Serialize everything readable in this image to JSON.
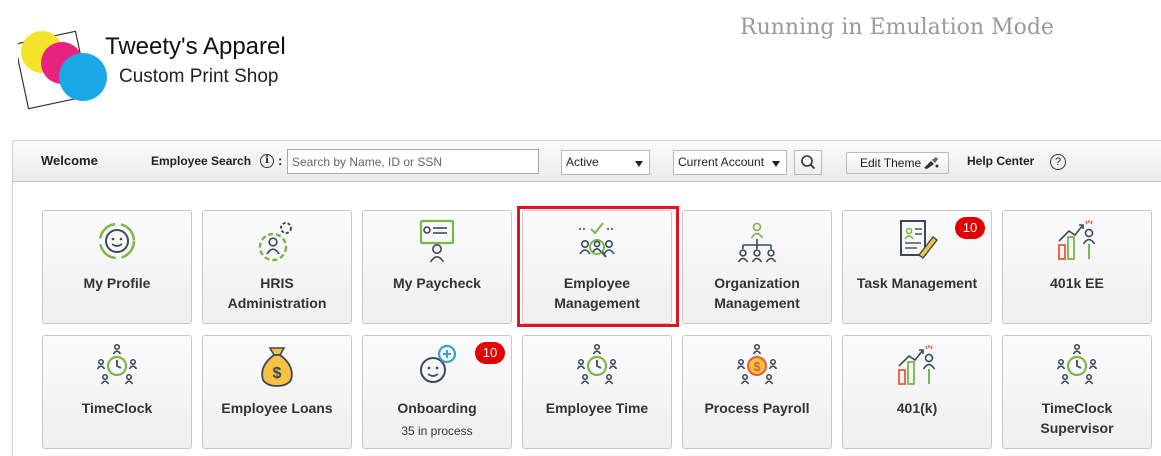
{
  "brand": {
    "name": "Tweety's Apparel",
    "tagline": "Custom Print Shop",
    "colors": [
      "#f5e22a",
      "#e8227f",
      "#1aa8e8"
    ]
  },
  "emulation_notice": "Running in Emulation Mode",
  "toolbar": {
    "welcome": "Welcome",
    "employee_search_label": "Employee Search",
    "info_icon": "i",
    "colon": ":",
    "search_placeholder": "Search by Name, ID or SSN",
    "status_select": "Active",
    "account_select": "Current Account",
    "edit_theme": "Edit Theme",
    "help_center": "Help Center",
    "help_icon": "?"
  },
  "tiles": [
    {
      "label": "My Profile",
      "icon": "profile-icon"
    },
    {
      "label": "HRIS\nAdministration",
      "icon": "hris-gear-icon"
    },
    {
      "label": "My Paycheck",
      "icon": "paycheck-icon"
    },
    {
      "label": "Employee\nManagement",
      "icon": "employee-management-icon",
      "highlighted": true
    },
    {
      "label": "Organization\nManagement",
      "icon": "org-chart-icon"
    },
    {
      "label": "Task Management",
      "icon": "task-icon",
      "badge": "10"
    },
    {
      "label": "401k EE",
      "icon": "growth-chart-icon"
    },
    {
      "label": "TimeClock",
      "icon": "timeclock-icon"
    },
    {
      "label": "Employee Loans",
      "icon": "money-bag-icon"
    },
    {
      "label": "Onboarding",
      "icon": "onboarding-icon",
      "badge": "10",
      "sub": "35 in process"
    },
    {
      "label": "Employee Time",
      "icon": "timeclock-icon"
    },
    {
      "label": "Process Payroll",
      "icon": "payroll-icon"
    },
    {
      "label": "401(k)",
      "icon": "growth-chart-icon"
    },
    {
      "label": "TimeClock\nSupervisor",
      "icon": "timeclock-icon"
    }
  ],
  "colors": {
    "icon_dark": "#3a4a5a",
    "icon_green": "#7ab648",
    "badge": "#e30000",
    "highlight": "#e2151f"
  }
}
